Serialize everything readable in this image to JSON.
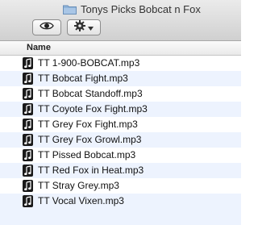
{
  "window": {
    "title": "Tonys Picks Bobcat n Fox",
    "title_icon": "folder-icon"
  },
  "toolbar": {
    "quicklook_icon": "eye-icon",
    "action_icon": "gear-icon",
    "action_menu_icon": "chevron-down-icon"
  },
  "list": {
    "column_header": "Name",
    "file_icon": "music-note-icon",
    "rows": [
      {
        "name": "TT 1-900-BOBCAT.mp3"
      },
      {
        "name": "TT Bobcat Fight.mp3"
      },
      {
        "name": "TT Bobcat Standoff.mp3"
      },
      {
        "name": "TT Coyote Fox Fight.mp3"
      },
      {
        "name": "TT Grey Fox Fight.mp3"
      },
      {
        "name": "TT Grey Fox Growl.mp3"
      },
      {
        "name": "TT Pissed Bobcat.mp3"
      },
      {
        "name": "TT Red Fox in Heat.mp3"
      },
      {
        "name": "TT Stray Grey.mp3"
      },
      {
        "name": "TT Vocal Vixen.mp3"
      }
    ]
  },
  "colors": {
    "stripe": "#edf3fe",
    "titlebar_top": "#ebebeb",
    "titlebar_bottom": "#d0d0d0"
  }
}
